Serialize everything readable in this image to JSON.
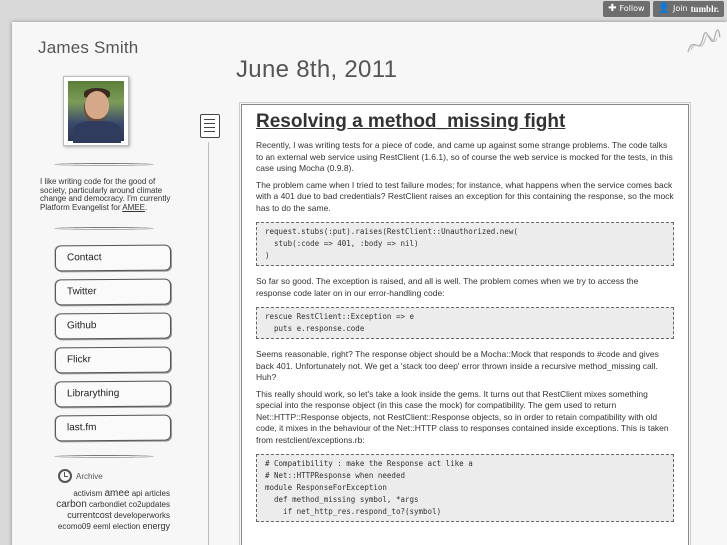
{
  "tumblr_controls": {
    "follow_label": "Follow",
    "join_label": "Join",
    "brand": "tumblr."
  },
  "sidebar": {
    "site_title": "James Smith",
    "bio_text": "I like writing code for the good of society, particularly around climate change and democracy. I'm currently Platform Evangelist for ",
    "bio_link": "AMEE",
    "bio_end": ".",
    "nav": [
      "Contact",
      "Twitter",
      "Github",
      "Flickr",
      "Librarything",
      "last.fm"
    ],
    "archive_label": "Archive",
    "tags": [
      {
        "text": "activism",
        "size": "sm"
      },
      {
        "text": "amee",
        "size": "lg"
      },
      {
        "text": "api",
        "size": "sm"
      },
      {
        "text": "articles",
        "size": "sm"
      },
      {
        "text": "carbon",
        "size": "lg"
      },
      {
        "text": "carbondiet",
        "size": "sm"
      },
      {
        "text": "co2updates",
        "size": "sm"
      },
      {
        "text": "currentcost",
        "size": "md"
      },
      {
        "text": "developerworks",
        "size": "sm"
      },
      {
        "text": "ecomo09",
        "size": "sm"
      },
      {
        "text": "eeml",
        "size": "sm"
      },
      {
        "text": "election",
        "size": "sm"
      },
      {
        "text": "energy",
        "size": "md"
      }
    ]
  },
  "main": {
    "date": "June 8th, 2011",
    "post": {
      "title": "Resolving a method_missing fight",
      "p1": "Recently, I was writing tests for a piece of code, and came up against some strange problems. The code talks to an external web service using RestClient (1.6.1), so of course the web service is mocked for the tests, in this case using Mocha (0.9.8).",
      "p2": "The problem came when I tried to test failure modes; for instance, what happens when the service comes back with a 401 due to bad credentials? RestClient raises an exception for this containing the response, so the mock has to do the same.",
      "code1": "request.stubs(:put).raises(RestClient::Unauthorized.new(\n  stub(:code => 401, :body => nil)\n)",
      "p3": "So far so good. The exception is raised, and all is well. The problem comes when we try to access the response code later on in our error-handling code:",
      "code2": "rescue RestClient::Exception => e\n  puts e.response.code",
      "p4": "Seems reasonable, right? The response object should be a Mocha::Mock that responds to #code and gives back 401. Unfortunately not. We get a 'stack too deep' error thrown inside a recursive method_missing call. Huh?",
      "p5": "This really should work, so let's take a look inside the gems. It turns out that RestClient mixes something special into the response object (in this case the mock) for compatibility. The gem used to return Net::HTTP::Response objects, not RestClient::Response objects, so in order to retain compatibility with old code, it mixes in the behaviour of the Net::HTTP class to responses contained inside exceptions. This is taken from restclient/exceptions.rb:",
      "code3": "# Compatibility : make the Response act like a\n# Net::HTTPResponse when needed\nmodule ResponseForException\n  def method_missing symbol, *args\n    if net_http_res.respond_to?(symbol)"
    }
  }
}
